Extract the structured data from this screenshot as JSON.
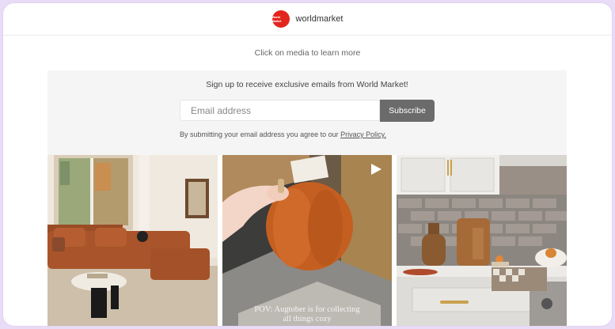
{
  "header": {
    "logo_text": "World Market",
    "brand_name": "worldmarket"
  },
  "hint": "Click on media to learn more",
  "signup": {
    "title": "Sign up to receive exclusive emails from World Market!",
    "email_placeholder": "Email address",
    "subscribe_label": "Subscribe",
    "disclaimer_text": "By submitting your email address you agree to our",
    "privacy_link": "Privacy Policy."
  },
  "media": [
    {
      "subject": "living room with rust sofa"
    },
    {
      "subject": "hand holding orange pumpkin pillow",
      "caption_line1": "POV: Augtober is for collecting",
      "caption_line2": "all things cozy"
    },
    {
      "subject": "kitchen counter with fall decor"
    }
  ],
  "colors": {
    "brand_red": "#e3261d",
    "subscribe_bg": "#6b6b6b",
    "frame": "#e9dcf7"
  }
}
